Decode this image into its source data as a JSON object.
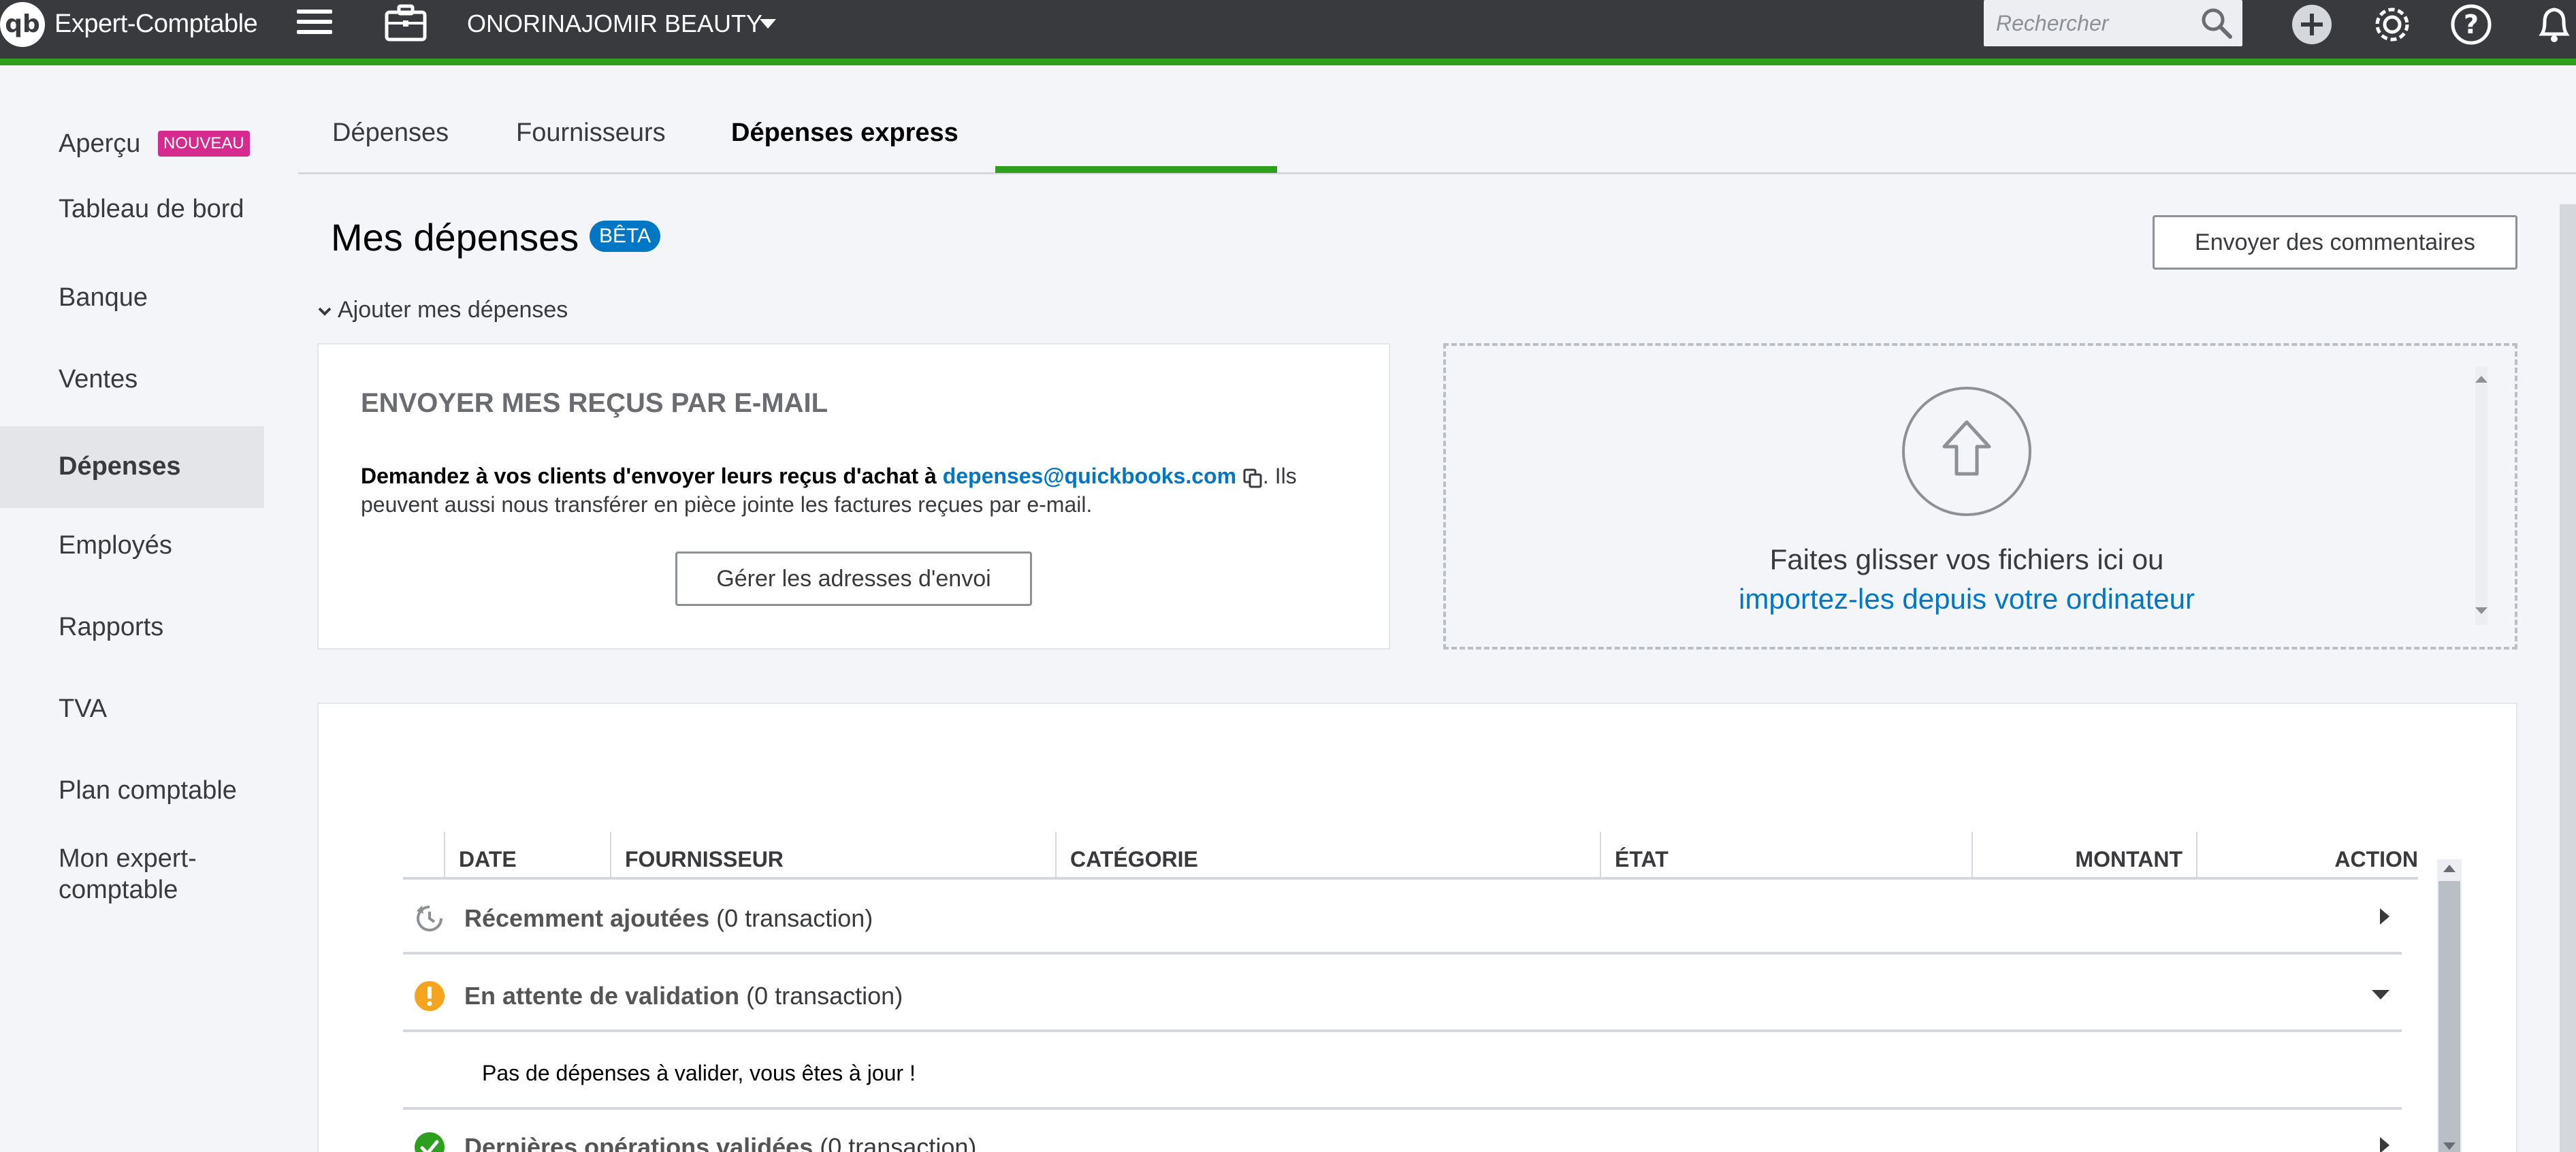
{
  "app": {
    "logo_text": "qb",
    "title": "Expert-Comptable",
    "company": "ONORINAJOMIR BEAUTY",
    "search_placeholder": "Rechercher"
  },
  "sidebar": {
    "items": [
      {
        "label": "Aperçu",
        "badge": "NOUVEAU"
      },
      {
        "label": "Tableau de bord"
      },
      {
        "label": "Banque"
      },
      {
        "label": "Ventes"
      },
      {
        "label": "Dépenses",
        "active": true
      },
      {
        "label": "Employés"
      },
      {
        "label": "Rapports"
      },
      {
        "label": "TVA"
      },
      {
        "label": "Plan comptable"
      },
      {
        "label": "Mon expert-comptable"
      }
    ]
  },
  "tabs": [
    {
      "label": "Dépenses"
    },
    {
      "label": "Fournisseurs"
    },
    {
      "label": "Dépenses express",
      "active": true
    }
  ],
  "header": {
    "title": "Mes dépenses",
    "badge": "BÊTA",
    "feedback_button": "Envoyer des commentaires",
    "add_expenses": "Ajouter mes dépenses"
  },
  "email_card": {
    "title": "ENVOYER MES REÇUS PAR E-MAIL",
    "text_strong": "Demandez à vos clients d'envoyer leurs reçus d'achat à",
    "email": "depenses@quickbooks.com",
    "text_rest": ". Ils peuvent aussi nous transférer en pièce jointe les factures reçues par e-mail.",
    "button": "Gérer les adresses d'envoi"
  },
  "dropzone": {
    "text": "Faites glisser vos fichiers ici ou",
    "link": "importez-les depuis votre ordinateur"
  },
  "table": {
    "columns": [
      "DATE",
      "FOURNISSEUR",
      "CATÉGORIE",
      "ÉTAT",
      "MONTANT",
      "ACTION"
    ],
    "groups": [
      {
        "label": "Récemment ajoutées",
        "count": "(0 transaction)",
        "icon": "clock-refresh-icon",
        "expanded": false
      },
      {
        "label": "En attente de validation",
        "count": "(0 transaction)",
        "icon": "warning-icon",
        "expanded": true,
        "empty_message": "Pas de dépenses à valider, vous êtes à jour !"
      },
      {
        "label": "Dernières opérations validées",
        "count": "(0 transaction)",
        "icon": "check-circle-icon",
        "expanded": false
      }
    ]
  },
  "colors": {
    "topbar": "#393a3d",
    "accent_green": "#2ca01c",
    "link_blue": "#0077c5",
    "badge_pink": "#d52b8f",
    "warning_orange": "#f4a41d"
  }
}
